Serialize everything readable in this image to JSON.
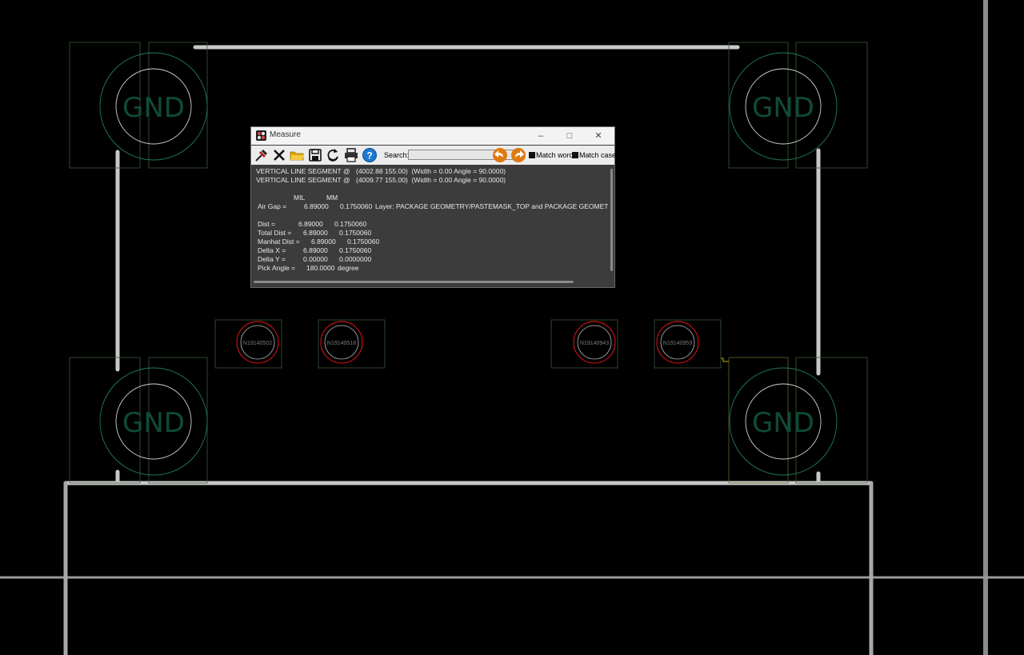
{
  "canvas": {
    "pad_labels": [
      "GND",
      "GND",
      "GND",
      "GND"
    ],
    "components": [
      "N19140502",
      "N19140518",
      "N19140943",
      "N19140959"
    ],
    "colors": {
      "background": "#000000",
      "outline": "#3a5a3a",
      "green_circle": "#1f7a55",
      "white_circle": "#cfcfcf",
      "red_circle": "#c01010",
      "trace": "#d0d0d0",
      "gnd_text": "#0f4a3a"
    }
  },
  "window": {
    "title": "Measure",
    "minimize_icon": "minimize-icon",
    "maximize_icon": "maximize-icon",
    "close_icon": "close-icon"
  },
  "toolbar": {
    "icons": [
      "pin-icon",
      "delete-icon",
      "folder-open-icon",
      "save-icon",
      "refresh-icon",
      "print-icon",
      "help-icon"
    ],
    "search_label": "Search:",
    "search_value": "",
    "prev_icon": "arrow-left-icon",
    "next_icon": "arrow-right-icon",
    "match_word_label": "Match word",
    "match_case_label": "Match case"
  },
  "output": {
    "seg1_label": "VERTICAL LINE SEGMENT @",
    "seg1_value": "(4002.88 155.00)  (Width = 0.00 Angle = 90.0000)",
    "seg2_label": "VERTICAL LINE SEGMENT @",
    "seg2_value": "(4009.77 155.00)  (Width = 0.00 Angle = 90.0000)",
    "col_mil": "MIL",
    "col_mm": "MM",
    "airgap_label": "Air Gap =",
    "airgap_mil": "6.89000",
    "airgap_mm": "0.1750060",
    "airgap_layer": "Layer: PACKAGE GEOMETRY/PASTEMASK_TOP and PACKAGE GEOMETRY/PASTEMASK_TOP",
    "dist_label": "Dist =",
    "dist_mil": "6.89000",
    "dist_mm": "0.1750060",
    "total_label": "Total Dist =",
    "total_mil": "6.89000",
    "total_mm": "0.1750060",
    "manhat_label": "Manhat Dist =",
    "manhat_mil": "6.89000",
    "manhat_mm": "0.1750060",
    "dx_label": "Delta X =",
    "dx_mil": "6.89000",
    "dx_mm": "0.1750060",
    "dy_label": "Delta Y =",
    "dy_mil": "0.00000",
    "dy_mm": "0.0000000",
    "angle_label": "Pick Angle =",
    "angle_value": "180.0000",
    "angle_unit": "degree"
  }
}
